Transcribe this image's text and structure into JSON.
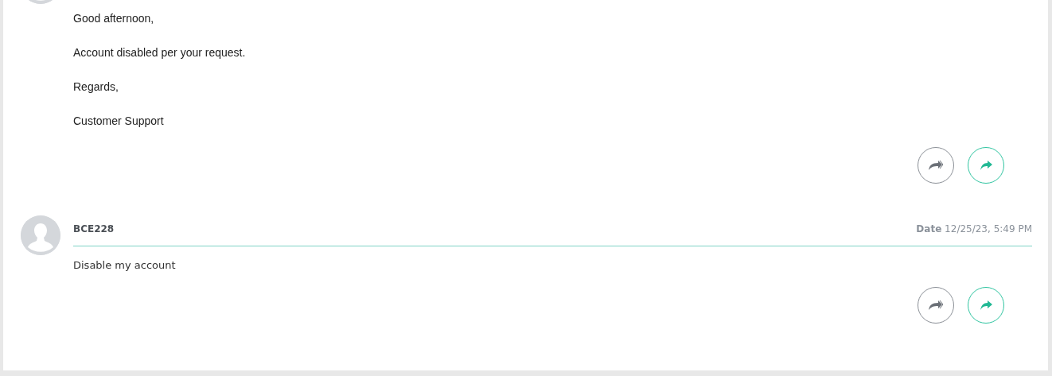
{
  "messages": [
    {
      "paragraphs": [
        "Good afternoon,",
        "Account disabled per your request.",
        "Regards,",
        "Customer Support"
      ]
    },
    {
      "author": "BCE228",
      "date_label": "Date",
      "date": "12/25/23, 5:49 PM",
      "paragraphs": [
        "Disable my account"
      ]
    }
  ]
}
